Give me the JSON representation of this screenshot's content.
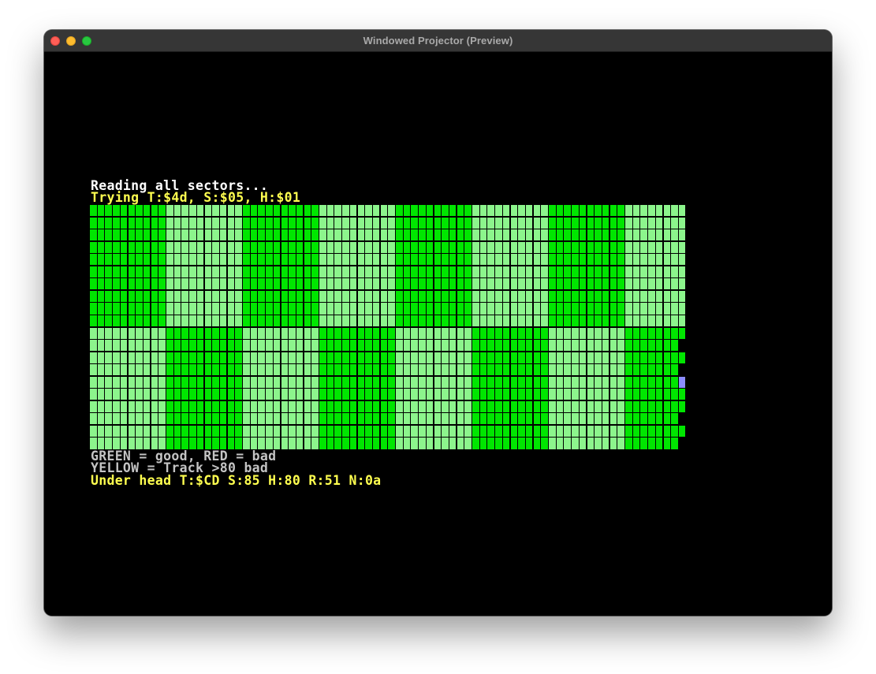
{
  "window": {
    "title": "Windowed Projector (Preview)"
  },
  "screen": {
    "status_line": "Reading all sectors...",
    "trying_line": "Trying T:$4d, S:$05, H:$01",
    "legend_line": "GREEN = good, RED = bad",
    "yellow_line": "YELLOW = Track >80 bad",
    "head_line": "Under head T:$CD S:85 H:80 R:51 N:0a"
  },
  "sector_map": {
    "columns": 78,
    "rows": 20,
    "block_columns": 10,
    "block_rows": 10,
    "incomplete_rows": [
      11,
      12,
      13,
      14,
      15,
      16,
      17,
      18,
      19
    ],
    "filled_tail_rows": [
      12,
      15,
      16,
      18
    ],
    "cursor_row": 14,
    "colors": {
      "good_dark": "#00e600",
      "good_light": "#8cf58c",
      "cursor": "#8c8cff",
      "gridline": "#000000"
    }
  },
  "colors": {
    "title_text": "#a9a9a9",
    "white_text": "#ffffff",
    "yellow_text": "#ffff4f",
    "grey_text": "#c4c4c4",
    "screen_bg": "#000000"
  }
}
